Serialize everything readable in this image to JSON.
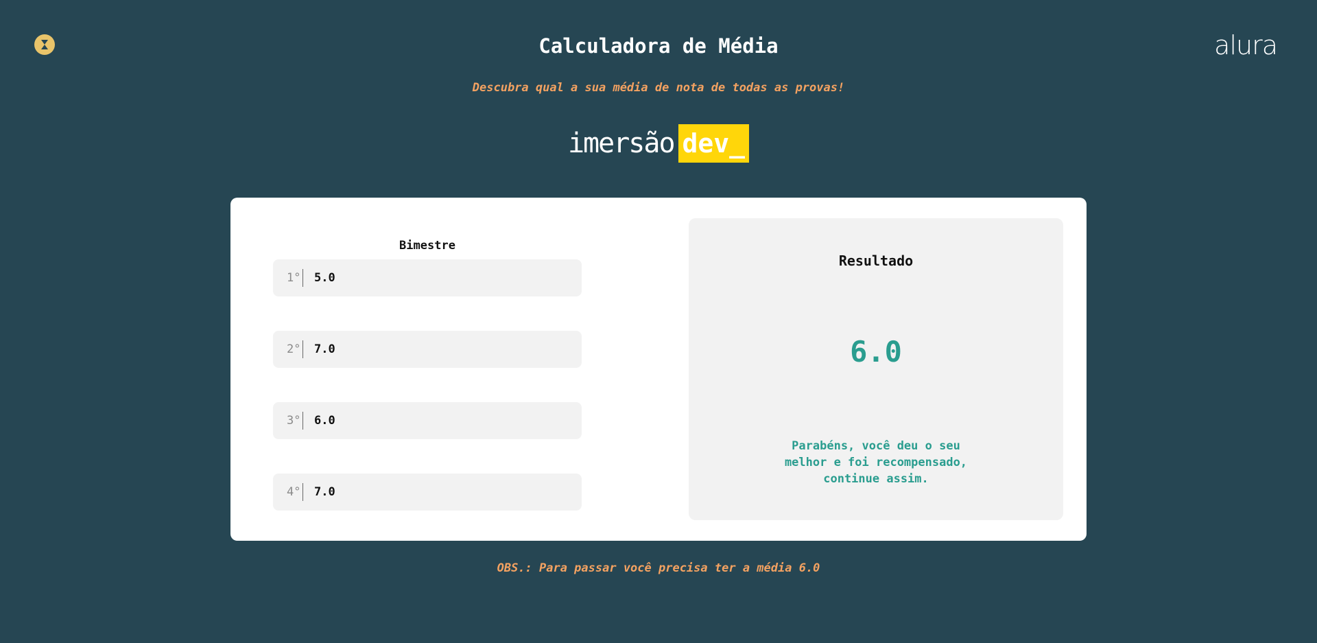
{
  "header": {
    "title": "Calculadora de Média",
    "subtitle": "Descubra qual a sua média de nota de todas as provas!",
    "brand": "alura",
    "app_icon": "hourglass-icon"
  },
  "logo": {
    "word": "imersão",
    "highlight": "dev_",
    "highlight_color": "#ffd60a"
  },
  "grades": {
    "heading": "Bimestre",
    "items": [
      {
        "label": "1°",
        "value": "5.0"
      },
      {
        "label": "2°",
        "value": "7.0"
      },
      {
        "label": "3°",
        "value": "6.0"
      },
      {
        "label": "4°",
        "value": "7.0"
      }
    ]
  },
  "result": {
    "heading": "Resultado",
    "value": "6.0",
    "message": "Parabéns, você deu o seu melhor e foi recompensado, continue assim."
  },
  "footer": {
    "note": "OBS.: Para passar você precisa ter a média 6.0"
  },
  "colors": {
    "background": "#264653",
    "accent_orange": "#f4a261",
    "accent_teal": "#2a9d8f",
    "icon_yellow": "#e9c46a"
  }
}
